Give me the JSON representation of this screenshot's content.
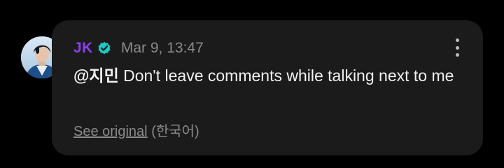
{
  "comment": {
    "author": "JK",
    "timestamp": "Mar 9, 13:47",
    "mention": "@지민",
    "text": " Don't leave comments while talking next to me",
    "see_original_label": "See original",
    "language_note": "(한국어)"
  },
  "colors": {
    "author": "#8b3ff0",
    "verified_badge": "#1fc7c1",
    "bubble_bg": "#1b1b1b",
    "page_bg": "#000000"
  },
  "icons": {
    "verified": "verified-badge-icon",
    "more": "more-vertical-icon"
  }
}
